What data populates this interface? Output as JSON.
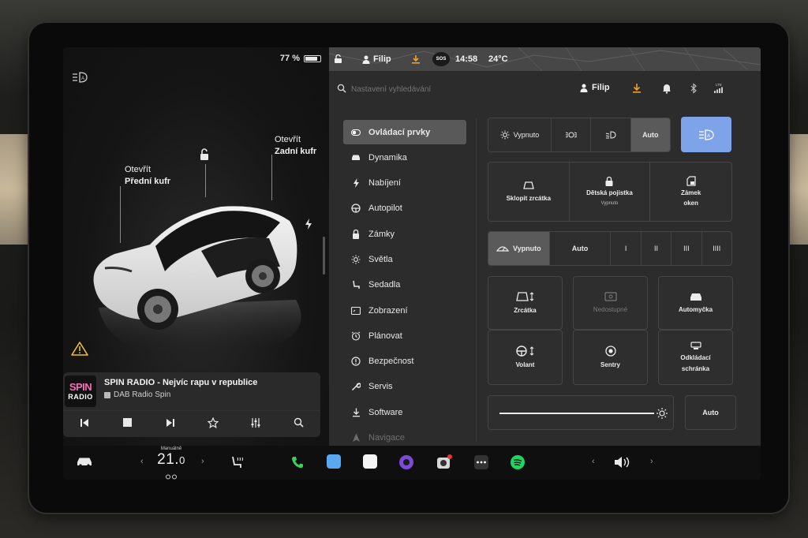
{
  "status": {
    "battery_percent": "77 %",
    "battery_level": 0.77,
    "user": "Filip",
    "time": "14:58",
    "temperature": "24°C",
    "sos": "SOS"
  },
  "car_view": {
    "front_trunk_line1": "Otevřít",
    "front_trunk_line2": "Přední kufr",
    "rear_trunk_line1": "Otevřít",
    "rear_trunk_line2": "Zadní kufr"
  },
  "media": {
    "logo_top": "SPIN",
    "logo_bottom": "RADIO",
    "title": "SPIN RADIO - Nejvíc rapu v republice",
    "source": "DAB Radio Spin"
  },
  "settings": {
    "search_placeholder": "Nastavení vyhledávání",
    "profile_name": "Filip",
    "nav": [
      {
        "label": "Ovládací prvky",
        "icon": "toggle-icon"
      },
      {
        "label": "Dynamika",
        "icon": "car-icon"
      },
      {
        "label": "Nabíjení",
        "icon": "bolt-icon"
      },
      {
        "label": "Autopilot",
        "icon": "steering-wheel-icon"
      },
      {
        "label": "Zámky",
        "icon": "lock-icon"
      },
      {
        "label": "Světla",
        "icon": "sun-icon"
      },
      {
        "label": "Sedadla",
        "icon": "seat-icon"
      },
      {
        "label": "Zobrazení",
        "icon": "display-icon"
      },
      {
        "label": "Plánovat",
        "icon": "alarm-clock-icon"
      },
      {
        "label": "Bezpečnost",
        "icon": "info-circle-icon"
      },
      {
        "label": "Servis",
        "icon": "wrench-icon"
      },
      {
        "label": "Software",
        "icon": "download-icon"
      },
      {
        "label": "Navigace",
        "icon": "navigation-arrow-icon"
      }
    ],
    "lights_off": "Vypnuto",
    "lights_auto": "Auto",
    "fold_mirrors": "Sklopit zrcátka",
    "child_lock": "Dětská pojistka",
    "child_lock_state": "Vypnuto",
    "window_lock_line1": "Zámek",
    "window_lock_line2": "oken",
    "wipers_off": "Vypnuto",
    "wipers_auto": "Auto",
    "wiper_speeds": [
      "I",
      "II",
      "III",
      "IIII"
    ],
    "mirrors": "Zrcátka",
    "unavailable": "Nedostupné",
    "car_wash": "Automyčka",
    "steering": "Volant",
    "sentry": "Sentry",
    "glovebox_line1": "Odkládací",
    "glovebox_line2": "schránka",
    "brightness_auto": "Auto"
  },
  "dock": {
    "climate_mode": "Manuálně",
    "temp_int": "21.",
    "temp_dec": "0"
  },
  "colors": {
    "accent_blue": "#7ea3e8",
    "download_orange": "#f0a030",
    "phone_green": "#3ccf5a"
  }
}
